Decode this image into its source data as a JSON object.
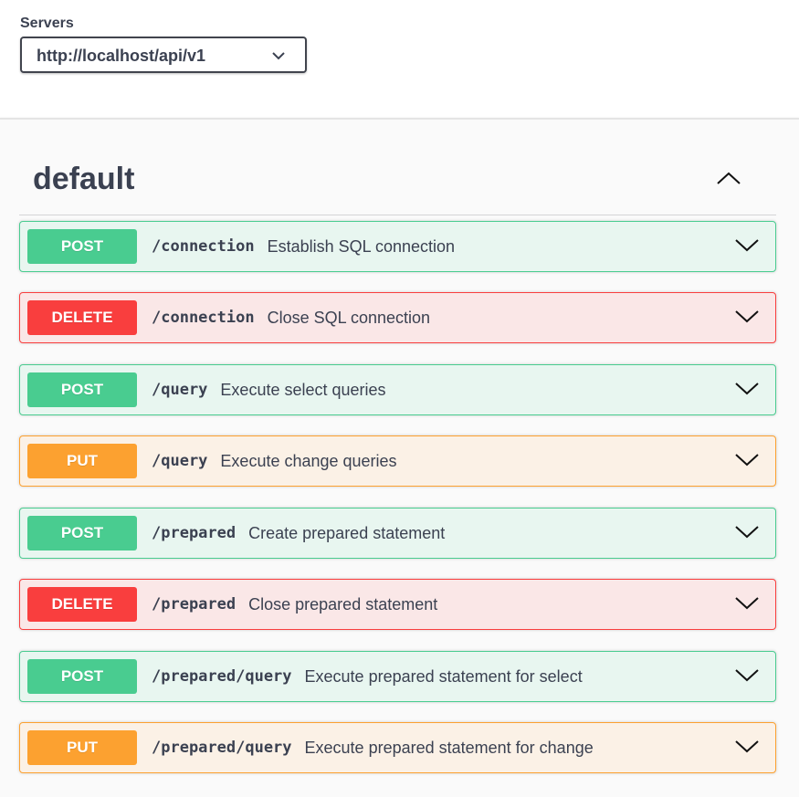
{
  "servers": {
    "label": "Servers",
    "selected": "http://localhost/api/v1"
  },
  "tag": {
    "name": "default",
    "toggle_icon": "chevron-up-icon"
  },
  "operations": [
    {
      "method": "POST",
      "path": "/connection",
      "summary": "Establish SQL connection"
    },
    {
      "method": "DELETE",
      "path": "/connection",
      "summary": "Close SQL connection"
    },
    {
      "method": "POST",
      "path": "/query",
      "summary": "Execute select queries"
    },
    {
      "method": "PUT",
      "path": "/query",
      "summary": "Execute change queries"
    },
    {
      "method": "POST",
      "path": "/prepared",
      "summary": "Create prepared statement"
    },
    {
      "method": "DELETE",
      "path": "/prepared",
      "summary": "Close prepared statement"
    },
    {
      "method": "POST",
      "path": "/prepared/query",
      "summary": "Execute prepared statement for select"
    },
    {
      "method": "PUT",
      "path": "/prepared/query",
      "summary": "Execute prepared statement for change"
    }
  ],
  "colors": {
    "post": "#49cc90",
    "delete": "#f93e3e",
    "put": "#fca130",
    "text": "#3b4151"
  }
}
